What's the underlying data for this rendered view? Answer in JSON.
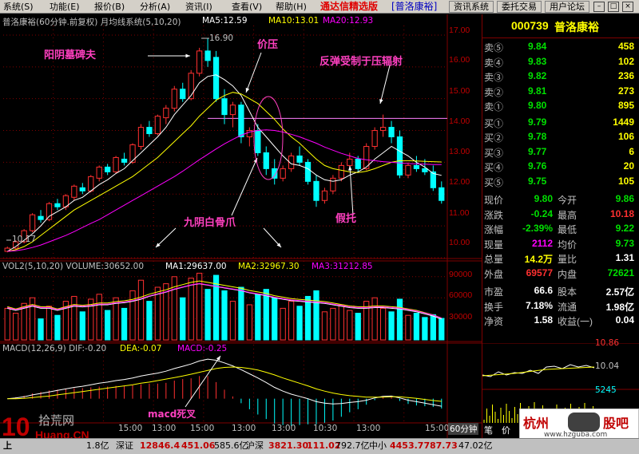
{
  "menu": [
    "系统(S)",
    "功能(E)",
    "报价(B)",
    "分析(A)",
    "资讯(I)",
    "查看(V)",
    "帮助(H)"
  ],
  "app_title": "通达信精选版",
  "stock_badge": "[普洛康裕]",
  "toolbar": [
    "资讯系统",
    "委托交易",
    "用户论坛"
  ],
  "win_buttons": [
    "–",
    "□",
    "×"
  ],
  "price_header": {
    "name": "普洛康裕(60分钟.前复权) 月均线系统(5,10,20)",
    "ma5": "MA5:12.59",
    "ma10": "MA10:13.01",
    "ma20": "MA20:12.93"
  },
  "price_axis": [
    "17.00",
    "16.00",
    "15.00",
    "14.00",
    "13.00",
    "12.00",
    "11.00",
    "10.00"
  ],
  "price_marks": {
    "high": "16.90",
    "low": "10.17"
  },
  "annotations": {
    "a1": "阳阴墓碑夫",
    "a2": "价压",
    "a3": "反弹受制于压辐射",
    "a4": "九阴白骨爪",
    "a5": "假托",
    "a6": "macd死叉"
  },
  "vol_header": {
    "name": "VOL2(5,10,20) VOLUME:30652.00",
    "ma1": "MA1:29637.00",
    "ma2": "MA2:32967.30",
    "ma3": "MA3:31212.85"
  },
  "vol_axis": [
    "90000",
    "60000",
    "30000"
  ],
  "macd_header": {
    "name": "MACD(12,26,9) DIF:-0.20",
    "dea": "DEA:-0.07",
    "macd": "MACD:-0.25"
  },
  "time_axis": [
    "15:00",
    "13:00",
    "15:00",
    "13:00",
    "13:00",
    "10:30",
    "13:00",
    "15:00"
  ],
  "period_label": "60分钟",
  "quote": {
    "code": "000739",
    "name": "普洛康裕",
    "asks": [
      {
        "label": "卖⑤",
        "price": "9.84",
        "vol": "458"
      },
      {
        "label": "卖④",
        "price": "9.83",
        "vol": "102"
      },
      {
        "label": "卖③",
        "price": "9.82",
        "vol": "236"
      },
      {
        "label": "卖②",
        "price": "9.81",
        "vol": "273"
      },
      {
        "label": "卖①",
        "price": "9.80",
        "vol": "895"
      }
    ],
    "bids": [
      {
        "label": "买①",
        "price": "9.79",
        "vol": "1449"
      },
      {
        "label": "买②",
        "price": "9.78",
        "vol": "106"
      },
      {
        "label": "买③",
        "price": "9.77",
        "vol": "6"
      },
      {
        "label": "买④",
        "price": "9.76",
        "vol": "20"
      },
      {
        "label": "买⑤",
        "price": "9.75",
        "vol": "105"
      }
    ],
    "stats": [
      {
        "l1": "现价",
        "v1": "9.80",
        "l2": "今开",
        "v2": "9.86",
        "c1": "#00e000",
        "c2": "#00e000"
      },
      {
        "l1": "涨跌",
        "v1": "-0.24",
        "l2": "最高",
        "v2": "10.18",
        "c1": "#00e000",
        "c2": "#ff3030"
      },
      {
        "l1": "涨幅",
        "v1": "-2.39%",
        "l2": "最低",
        "v2": "9.22",
        "c1": "#00e000",
        "c2": "#00e000"
      },
      {
        "l1": "现量",
        "v1": "2112",
        "l2": "均价",
        "v2": "9.73",
        "c1": "#ff00ff",
        "c2": "#00e000"
      },
      {
        "l1": "总量",
        "v1": "14.2万",
        "l2": "量比",
        "v2": "1.31",
        "c1": "#ffff00",
        "c2": "#ffffff"
      },
      {
        "l1": "外盘",
        "v1": "69577",
        "l2": "内盘",
        "v2": "72621",
        "c1": "#ff3030",
        "c2": "#00e000"
      }
    ],
    "fund": [
      {
        "l1": "市盈",
        "v1": "66.6",
        "l2": "股本",
        "v2": "2.57亿"
      },
      {
        "l1": "换手",
        "v1": "7.18%",
        "l2": "流通",
        "v2": "1.98亿"
      },
      {
        "l1": "净资",
        "v1": "1.58",
        "l2": "收益(一)",
        "v2": "0.04"
      }
    ],
    "mini": {
      "top": "10.86",
      "mid": "10.04",
      "vol": "5245"
    },
    "tabs": [
      "笔",
      "价",
      "细",
      "势",
      "指",
      "联",
      "值",
      "主",
      "筹"
    ]
  },
  "status": {
    "s1": "上",
    "s1v": "1.8亿",
    "sz_label": "深证",
    "sz_v": "12846.4",
    "sz_c": "451.06",
    "sz_a": "585.6亿",
    "hs_label": "沪深",
    "hs_v": "3821.30",
    "hs_c": "111.02",
    "hs_a": "792.7亿",
    "zx_label": "中小",
    "zx_v": "4453.77",
    "zx_c": "87.73",
    "zx_a": "47.02亿"
  },
  "logos": {
    "left": "10 拾荒网 10Huang.CN",
    "right": "杭州 股吧 www.hzguba.com"
  },
  "colors": {
    "up": "#ff3030",
    "down": "#00ffff",
    "ma5": "#ffffff",
    "ma10": "#ffff00",
    "ma20": "#ff00ff",
    "grid": "#800000"
  },
  "chart_data": {
    "type": "candlestick",
    "ohlc": [
      [
        10.2,
        10.35,
        10.17,
        10.3
      ],
      [
        10.3,
        10.55,
        10.25,
        10.5
      ],
      [
        10.5,
        10.9,
        10.45,
        10.85
      ],
      [
        10.85,
        11.4,
        10.8,
        11.35
      ],
      [
        11.3,
        11.5,
        11.1,
        11.2
      ],
      [
        11.2,
        11.75,
        11.15,
        11.7
      ],
      [
        11.7,
        11.85,
        11.5,
        11.6
      ],
      [
        11.6,
        12.0,
        11.5,
        11.95
      ],
      [
        11.9,
        12.3,
        11.8,
        12.25
      ],
      [
        12.2,
        12.35,
        12.0,
        12.1
      ],
      [
        12.1,
        12.6,
        12.05,
        12.55
      ],
      [
        12.5,
        12.9,
        12.4,
        12.85
      ],
      [
        12.85,
        12.95,
        12.6,
        12.7
      ],
      [
        12.7,
        13.2,
        12.65,
        13.15
      ],
      [
        13.1,
        13.3,
        12.9,
        13.0
      ],
      [
        13.0,
        13.6,
        12.95,
        13.55
      ],
      [
        13.5,
        14.2,
        13.4,
        14.1
      ],
      [
        14.1,
        14.3,
        13.8,
        13.9
      ],
      [
        13.9,
        14.5,
        13.85,
        14.45
      ],
      [
        14.4,
        14.8,
        14.2,
        14.7
      ],
      [
        14.7,
        15.4,
        14.6,
        15.3
      ],
      [
        15.3,
        15.5,
        14.9,
        15.0
      ],
      [
        15.0,
        15.9,
        14.95,
        15.8
      ],
      [
        15.8,
        16.6,
        15.7,
        16.5
      ],
      [
        16.5,
        16.9,
        16.0,
        16.2
      ],
      [
        16.3,
        16.5,
        14.9,
        15.0
      ],
      [
        15.0,
        15.3,
        14.2,
        14.5
      ],
      [
        14.5,
        14.9,
        14.1,
        14.8
      ],
      [
        14.8,
        14.9,
        13.6,
        13.8
      ],
      [
        13.8,
        14.1,
        13.5,
        14.0
      ],
      [
        14.0,
        14.2,
        13.2,
        13.3
      ],
      [
        13.3,
        13.5,
        12.6,
        12.8
      ],
      [
        12.8,
        13.1,
        12.3,
        12.5
      ],
      [
        12.5,
        12.9,
        12.4,
        12.8
      ],
      [
        12.8,
        13.3,
        12.7,
        13.2
      ],
      [
        13.2,
        13.5,
        12.9,
        13.0
      ],
      [
        13.0,
        13.1,
        12.3,
        12.4
      ],
      [
        12.4,
        12.6,
        11.6,
        11.8
      ],
      [
        11.8,
        12.2,
        11.7,
        12.1
      ],
      [
        12.1,
        12.6,
        12.0,
        12.5
      ],
      [
        12.5,
        13.0,
        12.4,
        12.9
      ],
      [
        12.9,
        13.3,
        12.8,
        13.1
      ],
      [
        13.1,
        13.2,
        12.7,
        12.8
      ],
      [
        12.8,
        13.6,
        12.75,
        13.5
      ],
      [
        13.5,
        14.1,
        13.4,
        14.0
      ],
      [
        14.0,
        14.5,
        13.8,
        14.1
      ],
      [
        14.1,
        14.3,
        13.6,
        13.8
      ],
      [
        13.8,
        14.0,
        12.5,
        12.6
      ],
      [
        12.6,
        13.0,
        12.5,
        12.9
      ],
      [
        12.9,
        13.2,
        12.7,
        12.8
      ],
      [
        12.8,
        13.1,
        12.6,
        12.7
      ],
      [
        12.7,
        12.9,
        12.1,
        12.2
      ],
      [
        12.2,
        12.4,
        11.7,
        11.8
      ]
    ],
    "ma5": [
      10.2,
      10.35,
      10.55,
      10.75,
      11.0,
      11.3,
      11.45,
      11.6,
      11.8,
      11.9,
      12.1,
      12.3,
      12.45,
      12.65,
      12.8,
      13.05,
      13.3,
      13.55,
      13.8,
      14.1,
      14.5,
      14.8,
      15.1,
      15.5,
      15.7,
      15.75,
      15.6,
      15.4,
      15.1,
      14.6,
      14.1,
      13.8,
      13.5,
      13.2,
      12.95,
      12.9,
      12.8,
      12.6,
      12.45,
      12.4,
      12.45,
      12.6,
      12.7,
      12.85,
      13.1,
      13.3,
      13.5,
      13.35,
      13.2,
      13.0,
      12.85,
      12.65,
      12.59
    ],
    "ma10": [
      10.2,
      10.25,
      10.35,
      10.5,
      10.7,
      10.9,
      11.1,
      11.3,
      11.5,
      11.65,
      11.8,
      11.95,
      12.1,
      12.25,
      12.4,
      12.55,
      12.75,
      12.95,
      13.15,
      13.4,
      13.65,
      13.9,
      14.15,
      14.45,
      14.7,
      14.95,
      15.1,
      15.2,
      15.15,
      15.0,
      14.85,
      14.6,
      14.35,
      14.05,
      13.8,
      13.6,
      13.35,
      13.1,
      12.9,
      12.8,
      12.75,
      12.7,
      12.68,
      12.72,
      12.8,
      12.9,
      13.0,
      13.05,
      13.05,
      13.04,
      13.03,
      13.02,
      13.01
    ],
    "ma20": [
      10.2,
      10.22,
      10.26,
      10.32,
      10.4,
      10.5,
      10.6,
      10.7,
      10.82,
      10.95,
      11.08,
      11.2,
      11.35,
      11.5,
      11.65,
      11.8,
      11.95,
      12.1,
      12.25,
      12.4,
      12.55,
      12.72,
      12.9,
      13.08,
      13.25,
      13.42,
      13.58,
      13.72,
      13.85,
      13.95,
      14.0,
      14.02,
      14.0,
      13.95,
      13.88,
      13.8,
      13.7,
      13.6,
      13.48,
      13.38,
      13.28,
      13.2,
      13.12,
      13.08,
      13.05,
      13.02,
      13.0,
      12.98,
      12.96,
      12.95,
      12.94,
      12.93,
      12.93
    ],
    "volume": [
      45000,
      38000,
      52000,
      60000,
      30000,
      48000,
      35000,
      55000,
      62000,
      40000,
      58000,
      65000,
      42000,
      60000,
      45000,
      70000,
      85000,
      55000,
      75000,
      80000,
      90000,
      60000,
      88000,
      95000,
      72000,
      92000,
      70000,
      55000,
      75000,
      50000,
      65000,
      72000,
      60000,
      45000,
      55000,
      48000,
      62000,
      70000,
      40000,
      45000,
      50000,
      42000,
      38000,
      55000,
      60000,
      45000,
      40000,
      58000,
      35000,
      38000,
      32000,
      36000,
      30652
    ],
    "vol_ma": [
      45000,
      42000,
      45000,
      48000,
      45000,
      45000,
      42000,
      45000,
      48000,
      47000,
      48000,
      50000,
      50000,
      52000,
      53000,
      55000,
      58000,
      62000,
      65000,
      68000,
      72000,
      75000,
      78000,
      80000,
      78000,
      76000,
      74000,
      72000,
      70000,
      67000,
      65000,
      63000,
      60000,
      58000,
      56000,
      55000,
      54000,
      53000,
      52000,
      50000,
      48000,
      46000,
      45000,
      45000,
      46000,
      46000,
      45000,
      44000,
      42000,
      40000,
      37000,
      34000,
      29637
    ],
    "macd_dif": [
      0,
      0.02,
      0.05,
      0.1,
      0.14,
      0.18,
      0.22,
      0.26,
      0.3,
      0.33,
      0.37,
      0.41,
      0.44,
      0.48,
      0.51,
      0.55,
      0.6,
      0.64,
      0.68,
      0.73,
      0.8,
      0.86,
      0.92,
      1.0,
      1.05,
      1.02,
      0.95,
      0.87,
      0.77,
      0.66,
      0.55,
      0.43,
      0.3,
      0.2,
      0.12,
      0.06,
      0.0,
      -0.08,
      -0.12,
      -0.14,
      -0.13,
      -0.1,
      -0.08,
      -0.04,
      0.02,
      0.06,
      0.07,
      0.02,
      -0.04,
      -0.08,
      -0.12,
      -0.16,
      -0.2
    ],
    "macd_dea": [
      0,
      0.0,
      0.01,
      0.03,
      0.05,
      0.07,
      0.1,
      0.13,
      0.16,
      0.19,
      0.22,
      0.25,
      0.28,
      0.31,
      0.34,
      0.37,
      0.41,
      0.44,
      0.48,
      0.52,
      0.56,
      0.6,
      0.65,
      0.7,
      0.75,
      0.8,
      0.83,
      0.84,
      0.83,
      0.8,
      0.76,
      0.7,
      0.63,
      0.55,
      0.48,
      0.41,
      0.34,
      0.26,
      0.2,
      0.15,
      0.11,
      0.08,
      0.06,
      0.04,
      0.04,
      0.04,
      0.05,
      0.05,
      0.03,
      0.01,
      -0.02,
      -0.05,
      -0.07
    ],
    "price_range": [
      10.0,
      17.3
    ],
    "vol_range": [
      0,
      100000
    ],
    "macd_range": [
      -0.6,
      1.2
    ]
  }
}
